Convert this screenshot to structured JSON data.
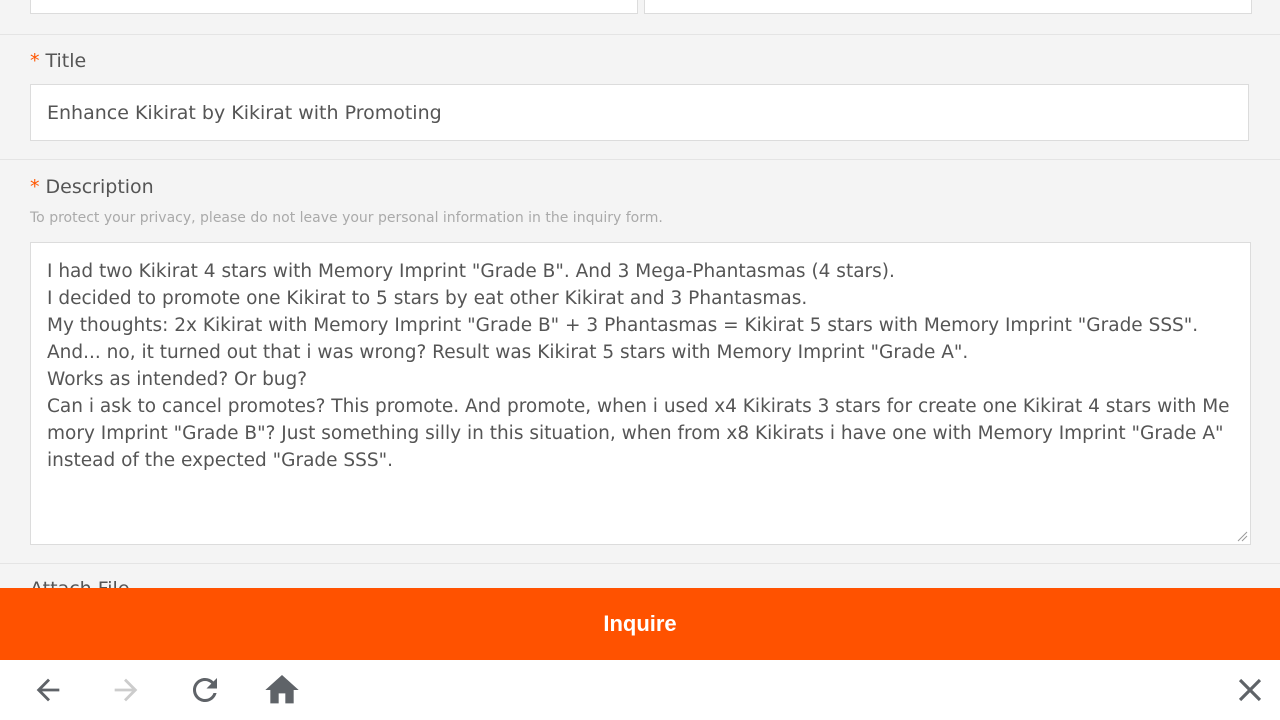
{
  "form": {
    "title": {
      "required_mark": "*",
      "label": "Title",
      "value": "Enhance Kikirat by Kikirat with Promoting"
    },
    "description": {
      "required_mark": "*",
      "label": "Description",
      "privacy_note": "To protect your privacy, please do not leave your personal information in the inquiry form.",
      "value": "I had two Kikirat 4 stars with Memory Imprint \"Grade B\". And 3 Mega-Phantasmas (4 stars).\nI decided to promote one Kikirat to 5 stars by eat other Kikirat and 3 Phantasmas.\nMy thoughts: 2x Kikirat with Memory Imprint \"Grade B\" + 3 Phantasmas = Kikirat 5 stars with Memory Imprint \"Grade SSS\".\nAnd... no, it turned out that i was wrong? Result was Kikirat 5 stars with Memory Imprint \"Grade A\".\nWorks as intended? Or bug?\nCan i ask to cancel promotes? This promote. And promote, when i used x4 Kikirats 3 stars for create one Kikirat 4 stars with Memory Imprint \"Grade B\"? Just something silly in this situation, when from x8 Kikirats i have one with Memory Imprint \"Grade A\" instead of the expected \"Grade SSS\"."
    },
    "attach_label": "Attach File"
  },
  "actions": {
    "inquire_label": "Inquire"
  },
  "nav": {
    "icons": [
      "back-arrow-icon",
      "forward-arrow-icon",
      "refresh-icon",
      "home-icon",
      "close-icon"
    ],
    "forward_enabled": false
  },
  "colors": {
    "accent": "#ff5200",
    "required": "#ff5500",
    "icon": "#5f6368",
    "icon_disabled": "#cccccc"
  }
}
